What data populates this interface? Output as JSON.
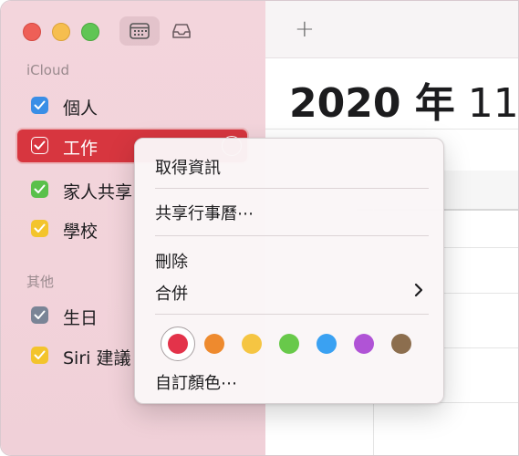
{
  "sidebar": {
    "toolbar": {
      "calendars_icon": "calendar-grid-icon",
      "inbox_icon": "inbox-tray-icon"
    },
    "sections": [
      {
        "label": "iCloud",
        "items": [
          {
            "label": "個人",
            "color": "#3a8ee6",
            "checked": true
          },
          {
            "label": "工作",
            "color": "#d7363f",
            "checked": true,
            "selected": true
          },
          {
            "label": "家人共享",
            "color": "#5ac04a",
            "checked": true
          },
          {
            "label": "學校",
            "color": "#f3c42c",
            "checked": true
          }
        ]
      },
      {
        "label": "其他",
        "items": [
          {
            "label": "生日",
            "color": "#7a8496",
            "checked": true
          },
          {
            "label": "Siri 建議",
            "color": "#f3c42c",
            "checked": true
          }
        ]
      }
    ]
  },
  "main": {
    "add_label": "+",
    "heading_year": "2020 年",
    "heading_month": "11"
  },
  "context_menu": {
    "get_info": "取得資訊",
    "share_calendar": "共享行事曆⋯",
    "delete": "刪除",
    "merge": "合併",
    "custom_color": "自訂顏色⋯",
    "swatches": [
      "#e3334a",
      "#ee8a2e",
      "#f5c542",
      "#68c94a",
      "#3aa1f2",
      "#b053d6",
      "#8c6e4e"
    ],
    "selected_swatch": 0
  }
}
